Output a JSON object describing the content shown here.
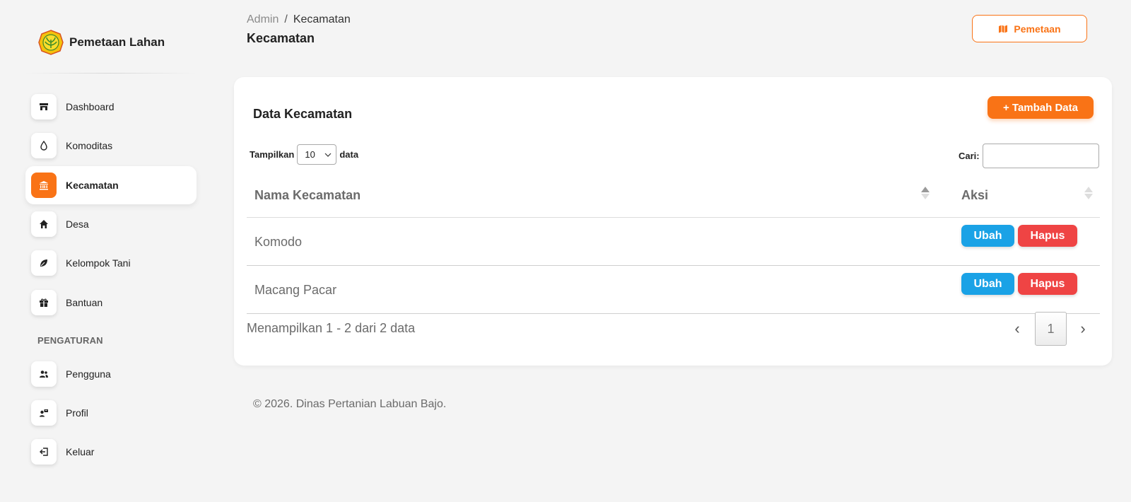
{
  "brand": {
    "name": "Pemetaan Lahan"
  },
  "sidebar": {
    "items": [
      {
        "label": "Dashboard",
        "icon": "store-icon"
      },
      {
        "label": "Komoditas",
        "icon": "drop-icon"
      },
      {
        "label": "Kecamatan",
        "icon": "building-icon",
        "active": true
      },
      {
        "label": "Desa",
        "icon": "home-icon"
      },
      {
        "label": "Kelompok Tani",
        "icon": "leaf-icon"
      },
      {
        "label": "Bantuan",
        "icon": "gift-icon"
      }
    ],
    "section_label": "PENGATURAN",
    "settings": [
      {
        "label": "Pengguna",
        "icon": "users-icon"
      },
      {
        "label": "Profil",
        "icon": "user-tag-icon"
      },
      {
        "label": "Keluar",
        "icon": "logout-icon"
      }
    ]
  },
  "header": {
    "breadcrumb_root": "Admin",
    "breadcrumb_sep": "/",
    "breadcrumb_current": "Kecamatan",
    "title": "Kecamatan",
    "map_button": "Pemetaan"
  },
  "card": {
    "title": "Data Kecamatan",
    "add_button": "+ Tambah Data",
    "length_prefix": "Tampilkan",
    "length_value": "10",
    "length_suffix": "data",
    "search_label": "Cari:",
    "search_value": ""
  },
  "table": {
    "columns": [
      "Nama Kecamatan",
      "Aksi"
    ],
    "rows": [
      {
        "name": "Komodo"
      },
      {
        "name": "Macang Pacar"
      }
    ],
    "edit_label": "Ubah",
    "delete_label": "Hapus"
  },
  "pagination": {
    "info": "Menampilkan 1 - 2 dari 2 data",
    "prev": "‹",
    "current": "1",
    "next": "›"
  },
  "footer": {
    "text": "© 2026. Dinas Pertanian Labuan Bajo."
  },
  "colors": {
    "accent": "#f97316",
    "edit": "#1aa2e6",
    "delete": "#ef4444"
  }
}
